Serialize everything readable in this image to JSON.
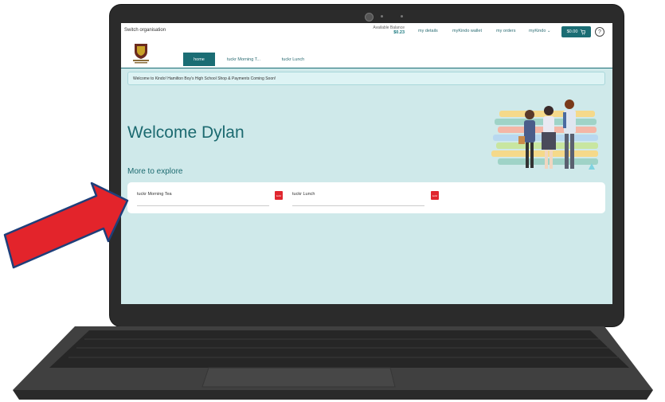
{
  "topbar": {
    "switch_org": "Switch organisation",
    "balance_label": "Available Balance",
    "balance_value": "$0.23",
    "nav": [
      "my details",
      "myKindo wallet",
      "my orders",
      "myKindo ⌄"
    ],
    "cart_label": "$0.00"
  },
  "tabs": [
    "home",
    "tuckr Morning T...",
    "tuckr Lunch"
  ],
  "banner": "Welcome to Kindo! Hamilton Boy's High School Shop & Payments Coming Soon!",
  "welcome": "Welcome Dylan",
  "more_heading": "More to explore",
  "explore_items": [
    {
      "label": "tuckr Morning Tea",
      "badge": "tuckr"
    },
    {
      "label": "tuckr Lunch",
      "badge": "tuckr"
    }
  ],
  "colors": {
    "accent": "#1b6d74",
    "page_bg": "#cfe9ea",
    "arrow": "#e3242b",
    "badge": "#e0262e"
  }
}
